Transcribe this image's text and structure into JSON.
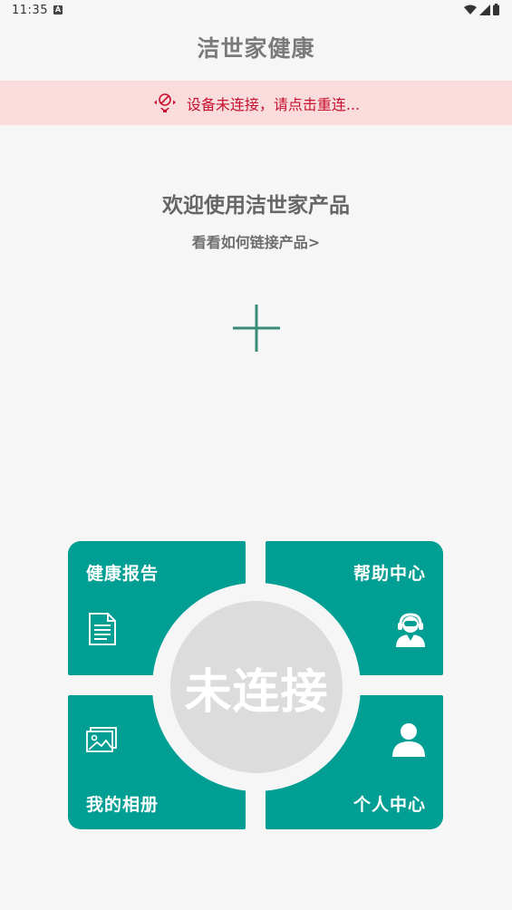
{
  "status_bar": {
    "time": "11:35",
    "notif_badge": "A"
  },
  "header": {
    "title": "洁世家健康"
  },
  "banner": {
    "text": "设备未连接，请点击重连...",
    "color": "#c8102e",
    "icon": "device-disconnected-icon"
  },
  "welcome": {
    "title": "欢迎使用洁世家产品",
    "link": "看看如何链接产品>"
  },
  "add_button": {
    "icon": "plus-icon",
    "color": "#3a8a78"
  },
  "menu": {
    "accent": "#009e93",
    "health_report": {
      "label": "健康报告",
      "icon": "document-icon"
    },
    "help_center": {
      "label": "帮助中心",
      "icon": "support-agent-icon"
    },
    "album": {
      "label": "我的相册",
      "icon": "image-icon"
    },
    "profile": {
      "label": "个人中心",
      "icon": "user-icon"
    },
    "center_status": "未连接"
  }
}
